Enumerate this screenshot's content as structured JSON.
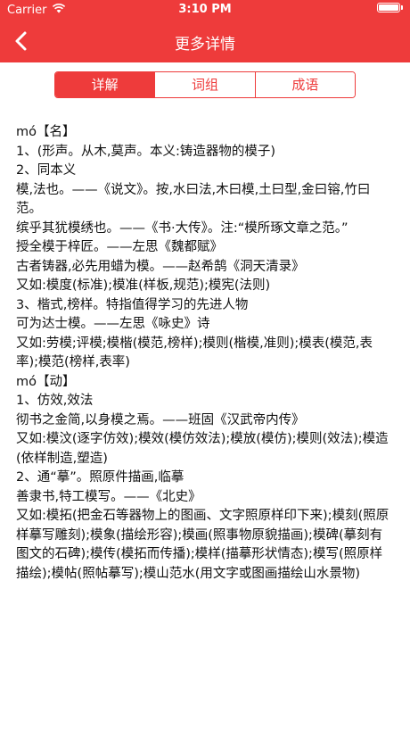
{
  "status_bar": {
    "carrier": "Carrier",
    "time": "3:10 PM",
    "wifi_icon": "wifi-icon",
    "battery_icon": "battery-icon"
  },
  "nav": {
    "title": "更多详情",
    "back_icon": "chevron-left-icon"
  },
  "tabs": [
    {
      "label": "详解",
      "active": true
    },
    {
      "label": "词组",
      "active": false
    },
    {
      "label": "成语",
      "active": false
    }
  ],
  "content": {
    "lines": [
      "mó【名】",
      "1、(形声。从木,莫声。本义:铸造器物的模子)",
      "2、同本义",
      "模,法也。——《说文》。按,水曰法,木曰模,土曰型,金曰镕,竹曰范。",
      "缤乎其犹模绣也。——《书·大传》。注:“模所琢文章之范。”",
      "授全模于梓匠。——左思《魏都赋》",
      "古者铸器,必先用蜡为模。——赵希鹄《洞天清录》",
      "又如:模度(标准);模准(样板,规范);模宪(法则)",
      "3、楷式,榜样。特指值得学习的先进人物",
      "可为达士模。——左思《咏史》诗",
      "又如:劳模;评模;模楷(模范,榜样);模则(楷模,准则);模表(模范,表率);模范(榜样,表率)",
      "mó【动】",
      "1、仿效,效法",
      "彻书之金简,以身模之焉。——班固《汉武帝内传》",
      "又如:模汶(逐字仿效);模效(模仿效法);模放(模仿);模则(效法);模造(依样制造,塑造)",
      "2、通“摹”。照原件描画,临摹",
      "善隶书,特工模写。——《北史》",
      "又如:模拓(把金石等器物上的图画、文字照原样印下来);模刻(照原样摹写雕刻);模象(描绘形容);模画(照事物原貌描画);模碑(摹刻有图文的石碑);模传(模拓而传播);模样(描摹形状情态);模写(照原样描绘);模帖(照帖摹写);模山范水(用文字或图画描绘山水景物)"
    ]
  },
  "colors": {
    "accent": "#ee3b3b",
    "text": "#111111",
    "background": "#ffffff"
  }
}
